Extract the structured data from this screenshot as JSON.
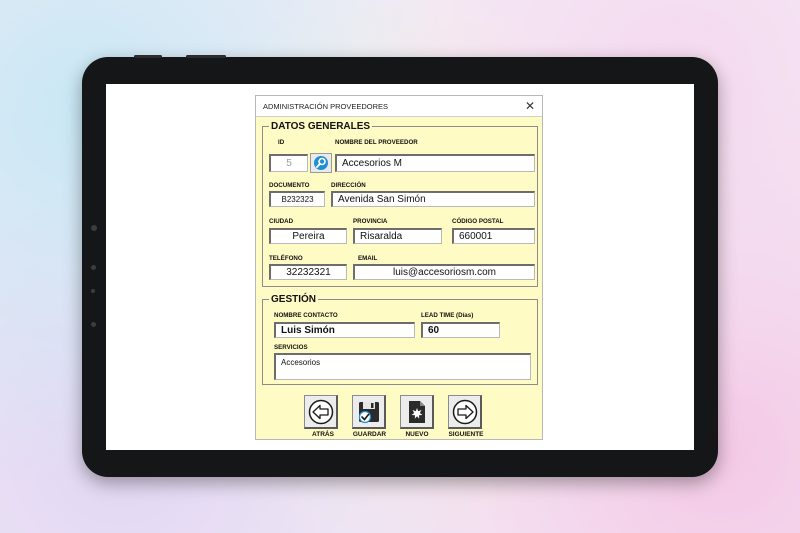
{
  "window": {
    "title": "ADMINISTRACIÓN PROVEEDORES",
    "close_glyph": "✕"
  },
  "datos_generales": {
    "legend": "DATOS GENERALES",
    "id": {
      "label": "ID",
      "value": "5"
    },
    "nombre": {
      "label": "NOMBRE DEL PROVEEDOR",
      "value": "Accesorios M"
    },
    "documento": {
      "label": "DOCUMENTO",
      "value": "B232323"
    },
    "direccion": {
      "label": "DIRECCIÓN",
      "value": "Avenida San Simón"
    },
    "ciudad": {
      "label": "CIUDAD",
      "value": "Pereira"
    },
    "provincia": {
      "label": "PROVINCIA",
      "value": "Risaralda"
    },
    "codigo_postal": {
      "label": "CÓDIGO POSTAL",
      "value": "660001"
    },
    "telefono": {
      "label": "TELÉFONO",
      "value": "32232321"
    },
    "email": {
      "label": "EMAIL",
      "value": "luis@accesoriosm.com"
    }
  },
  "gestion": {
    "legend": "GESTIÓN",
    "contacto": {
      "label": "NOMBRE CONTACTO",
      "value": "Luis Simón"
    },
    "lead_time": {
      "label": "LEAD TIME (Días)",
      "value": "60"
    },
    "servicios": {
      "label": "SERVICIOS",
      "value": "Accesorios"
    }
  },
  "buttons": {
    "atras": "ATRÁS",
    "guardar": "GUARDAR",
    "nuevo": "NUEVO",
    "siguiente": "SIGUIENTE"
  },
  "icons": {
    "search": "search-icon",
    "atras": "arrow-left-icon",
    "guardar": "save-icon",
    "nuevo": "new-document-icon",
    "siguiente": "arrow-right-icon"
  },
  "colors": {
    "dialog_bg": "#fffbc4",
    "tablet": "#151617",
    "search_accent": "#1e8fd5"
  }
}
